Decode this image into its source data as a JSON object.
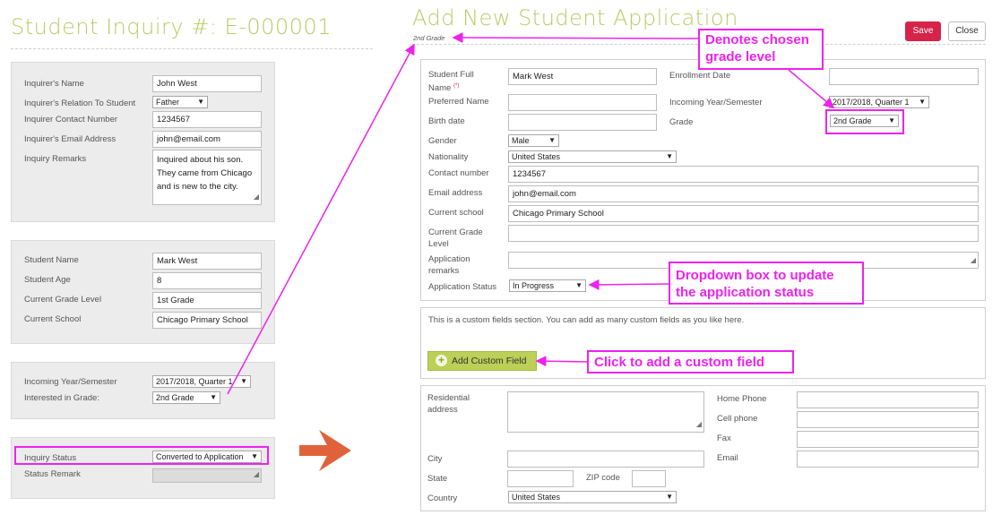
{
  "left": {
    "title": "Student Inquiry #: E-000001",
    "inquirer": {
      "name_label": "Inquirer's Name",
      "name_value": "John West",
      "relation_label": "Inquirer's Relation To Student",
      "relation_value": "Father",
      "contact_label": "Inquirer Contact Number",
      "contact_value": "1234567",
      "email_label": "Inquirer's Email Address",
      "email_value": "john@email.com",
      "remarks_label": "Inquiry Remarks",
      "remarks_lines": [
        "Inquired about his son.",
        "They came from Chicago",
        "and is new to the city."
      ]
    },
    "student": {
      "name_label": "Student Name",
      "name_value": "Mark West",
      "age_label": "Student Age",
      "age_value": "8",
      "grade_label": "Current Grade Level",
      "grade_value": "1st Grade",
      "school_label": "Current School",
      "school_value": "Chicago Primary School"
    },
    "interest": {
      "year_label": "Incoming Year/Semester",
      "year_value": "2017/2018, Quarter 1",
      "grade_label": "Interested in Grade:",
      "grade_value": "2nd Grade"
    },
    "status": {
      "status_label": "Inquiry Status",
      "status_value": "Converted to Application",
      "remark_label": "Status Remark"
    }
  },
  "right": {
    "title": "Add New Student Application",
    "subtitle": "2nd Grade",
    "save_label": "Save",
    "close_label": "Close",
    "main": {
      "fullname_label_1": "Student Full",
      "fullname_label_2": "Name",
      "required_mark": "(*)",
      "fullname_value": "Mark West",
      "preferred_label": "Preferred Name",
      "birth_label": "Birth date",
      "gender_label": "Gender",
      "gender_value": "Male",
      "nationality_label": "Nationality",
      "nationality_value": "United States",
      "contact_label": "Contact number",
      "contact_value": "1234567",
      "email_label": "Email address",
      "email_value": "john@email.com",
      "school_label": "Current school",
      "school_value": "Chicago Primary School",
      "grade_level_label_1": "Current Grade",
      "grade_level_label_2": "Level",
      "remarks_label_1": "Application",
      "remarks_label_2": "remarks",
      "status_label": "Application Status",
      "status_value": "In Progress",
      "enrollment_label": "Enrollment Date",
      "year_label": "Incoming Year/Semester",
      "year_value": "2017/2018, Quarter 1",
      "grade_label": "Grade",
      "grade_value": "2nd Grade"
    },
    "custom": {
      "description": "This is a custom fields section. You can add as many custom fields as you like here.",
      "add_label": "Add Custom Field"
    },
    "address": {
      "residential_label_1": "Residential",
      "residential_label_2": "address",
      "city_label": "City",
      "state_label": "State",
      "zip_label": "ZIP code",
      "country_label": "Country",
      "country_value": "United States",
      "home_phone_label": "Home Phone",
      "cell_phone_label": "Cell phone",
      "fax_label": "Fax",
      "email_label": "Email"
    }
  },
  "annotations": {
    "grade_level": [
      "Denotes chosen",
      "grade level"
    ],
    "status_dropdown": [
      "Dropdown box to update",
      "the application status"
    ],
    "custom_field": "Click to add a custom field"
  },
  "icons": {
    "arrow_right": "→",
    "dropdown": "▼",
    "resize": "◢",
    "plus": "+"
  },
  "colors": {
    "title_green": "#b8cc64",
    "annotation_magenta": "#ee22ee",
    "save_red": "#d6234a",
    "add_button_green": "#bccf57",
    "transition_arrow": "#e0623a"
  }
}
